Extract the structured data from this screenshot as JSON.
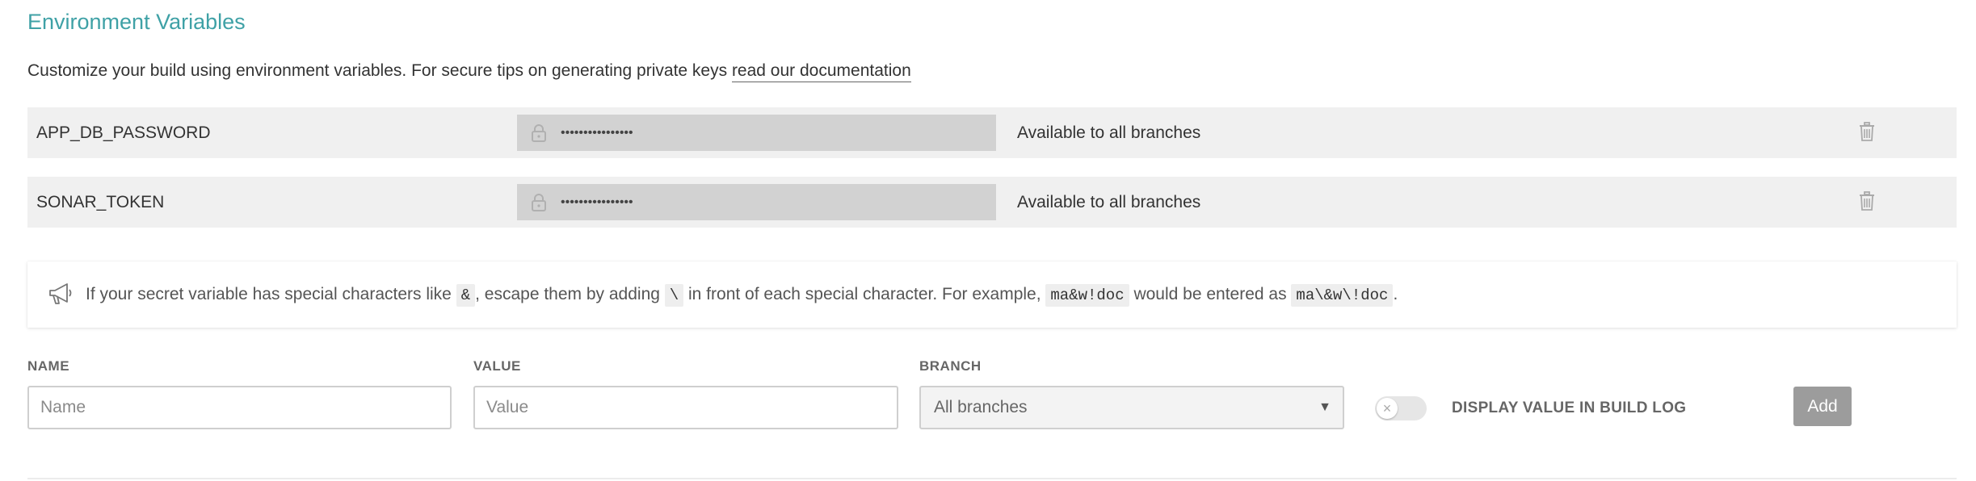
{
  "section": {
    "title": "Environment Variables",
    "description": "Customize your build using environment variables. For secure tips on generating private keys ",
    "doc_link": "read our documentation"
  },
  "variables": [
    {
      "name": "APP_DB_PASSWORD",
      "value_masked": "••••••••••••••••",
      "branch": "Available to all branches"
    },
    {
      "name": "SONAR_TOKEN",
      "value_masked": "••••••••••••••••",
      "branch": "Available to all branches"
    }
  ],
  "notice": {
    "icon": "megaphone-icon",
    "part1": "If your secret variable has special characters like ",
    "code1": "&",
    "part2": ", escape them by adding ",
    "code2": "\\",
    "part3": " in front of each special character. For example, ",
    "code3": "ma&w!doc",
    "part4": " would be entered as ",
    "code4": "ma\\&w\\!doc",
    "part5": "."
  },
  "form": {
    "name_label": "NAME",
    "name_placeholder": "Name",
    "value_label": "VALUE",
    "value_placeholder": "Value",
    "branch_label": "BRANCH",
    "branch_selected": "All branches",
    "display_toggle_label": "DISPLAY VALUE IN BUILD LOG",
    "display_toggle_on": false,
    "add_label": "Add"
  },
  "colors": {
    "title": "#3fa1a6",
    "row_bg": "#f0f0f0",
    "masked_bg": "#d2d2d2",
    "add_button": "#9c9c9c"
  }
}
